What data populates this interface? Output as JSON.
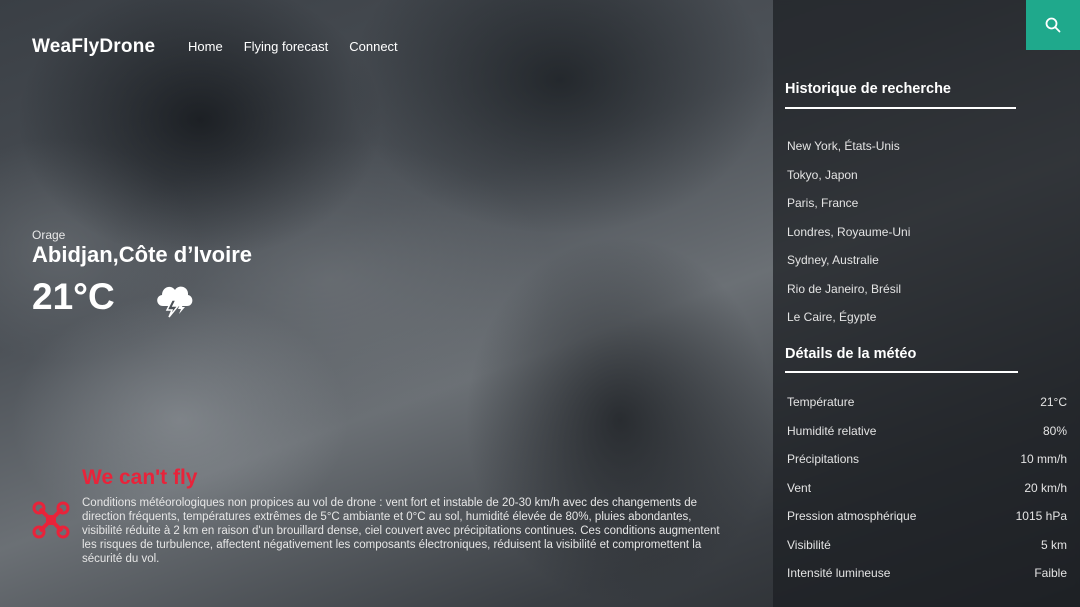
{
  "header": {
    "logo": "WeaFlyDrone",
    "nav": [
      "Home",
      "Flying forecast",
      "Connect"
    ]
  },
  "current": {
    "condition": "Orage",
    "location": "Abidjan,Côte d’Ivoire",
    "temperature": "21°C",
    "icon": "thunderstorm-cloud-icon"
  },
  "verdict": {
    "title": "We can't fly",
    "icon": "drone-icon",
    "color": "#e8233a",
    "text": "Conditions météorologiques non propices au vol de drone : vent fort et instable de 20-30 km/h avec des changements de direction fréquents, températures extrêmes de 5°C ambiante et 0°C au sol, humidité élevée de 80%, pluies abondantes, visibilité réduite à 2 km en raison d'un brouillard dense, ciel couvert avec précipitations continues. Ces conditions augmentent les risques de turbulence, affectent négativement les composants électroniques, réduisent la visibilité et compromettent la sécurité du vol."
  },
  "panel": {
    "search_icon": "search-icon",
    "accent": "#1fa98c",
    "history_title": "Historique de recherche",
    "history": [
      "New York, États-Unis",
      "Tokyo, Japon",
      "Paris, France",
      "Londres, Royaume-Uni",
      "Sydney, Australie",
      "Rio de Janeiro, Brésil",
      "Le Caire, Égypte"
    ],
    "details_title": "Détails de la météo",
    "details": [
      {
        "label": "Température",
        "value": "21°C"
      },
      {
        "label": "Humidité relative",
        "value": "80%"
      },
      {
        "label": "Précipitations",
        "value": "10 mm/h"
      },
      {
        "label": "Vent",
        "value": "20 km/h"
      },
      {
        "label": "Pression atmosphérique",
        "value": "1015 hPa"
      },
      {
        "label": "Visibilité",
        "value": "5 km"
      },
      {
        "label": "Intensité lumineuse",
        "value": "Faible"
      }
    ]
  }
}
